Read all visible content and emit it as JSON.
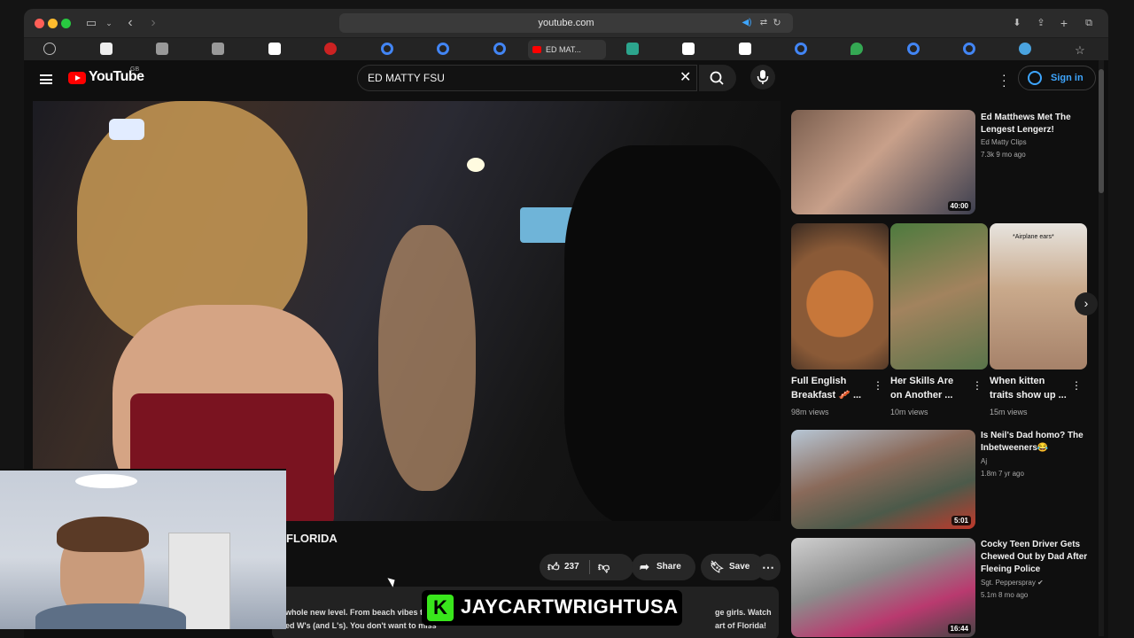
{
  "browser": {
    "url": "youtube.com",
    "active_tab_title": "ED MAT..."
  },
  "youtube": {
    "logo_text": "YouTube",
    "logo_region": "GB",
    "search_query": "ED MATTY FSU",
    "signin_label": "Sign in"
  },
  "video": {
    "title_fragment": "FLORIDA",
    "like_count": "237",
    "share_label": "Share",
    "save_label": "Save",
    "description_line1": "whole new level. From beach vibes to co",
    "description_line1_end": "ge girls. Watch",
    "description_line2": "ed W's (and L's). You don't want to miss",
    "description_line2_end": "art of Florida!"
  },
  "watermark": {
    "badge": "K",
    "text": "JAYCARTWRIGHTUSA"
  },
  "sidebar": {
    "top_video": {
      "title_line1": "Ed Matthews Met The",
      "title_line2": "Lengest Lengerz!",
      "channel": "Ed Matty Clips",
      "meta": "7.3k  9 mo ago",
      "duration": "40:00"
    },
    "shorts": [
      {
        "title_line1": "Full English",
        "title_line2": "Breakfast 🥓 ...",
        "views": "98m views"
      },
      {
        "title_line1": "Her Skills Are",
        "title_line2": "on Another ...",
        "views": "10m views"
      },
      {
        "title_line1": "When kitten",
        "title_line2": "traits show up ...",
        "views": "15m views",
        "overlay": "*Airplane ears*"
      }
    ],
    "videos": [
      {
        "title_line1": "Is Neil's Dad homo? The",
        "title_line2": "Inbetweeners😂",
        "channel": "Aj",
        "meta": "1.8m  7 yr ago",
        "duration": "5:01"
      },
      {
        "title_line1": "Cocky Teen Driver Gets",
        "title_line2": "Chewed Out by Dad After",
        "title_line3": "Fleeing Police",
        "channel": "Sgt. Pepperspray",
        "meta": "5.1m  8 mo ago",
        "duration": "16:44"
      }
    ]
  },
  "colors": {
    "youtube_red": "#ff0000",
    "link_blue": "#3ea6ff",
    "watermark_green": "#39e61c"
  }
}
